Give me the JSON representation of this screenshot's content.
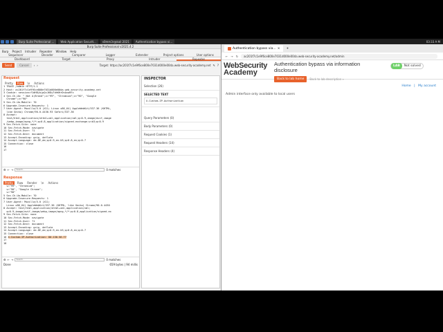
{
  "taskbar": {
    "tabs": [
      "Burp Suite Professional ...",
      "Web Application Securit...",
      "s0mm3r@kali:2021",
      "Authentication bypass vi..."
    ],
    "clock": "03:33 A M"
  },
  "burp": {
    "title": "Burp Suite Professional v2021.4.2",
    "menu": [
      "Burp",
      "Project",
      "Intruder",
      "Repeater",
      "Window",
      "Help"
    ],
    "tabs_top": [
      "Sequencer",
      "Decoder",
      "Comparer",
      "Logger",
      "Extender",
      "Project options",
      "User options"
    ],
    "tabs_bottom": [
      "Dashboard",
      "Target",
      "Proxy",
      "Intruder",
      "Repeater"
    ],
    "send_label": "Send",
    "cancel_label": "Cancel",
    "target": "Target: https://ac201f7c1e9f6ce800e7031d000e00da.web-security-academy.net",
    "request": {
      "title": "Request",
      "subtabs": [
        "Pretty",
        "Raw",
        "\\n",
        "Actions"
      ],
      "lines": [
        "1 TRACE /admin HTTP/1.1",
        "2 Host: ac201f7c1e9f6ce800e7031d000e00da.web-security-academy.net",
        "3 Cookie: session=f1dH8jbjpQcJ6DyTdhKHrDnAvwRFz",
        "4 Sec-Ch-Ua: \" Not A;Brand\";v=\"99\", \"Chromium\";v=\"90\", \"Google",
        "  Chrome\";v=\"90\"",
        "5 Sec-Ch-Ua-Mobile: ?0",
        "6 Upgrade-Insecure-Requests: 1",
        "7 User-Agent: Mozilla/5.0 (X11; Linux x86_64) AppleWebKit/537.36 (KHTML,",
        "  like Gecko) Chrome/90.0.4430.93 Safari/537.36",
        "8 Accept:",
        "  text/html,application/xhtml+xml,application/xml;q=0.9,image/avif,image",
        "  /webp,image/apng,*/*;q=0.8,application/signed-exchange;v=b3;q=0.9",
        "9 Sec-Fetch-Site: none",
        "10 Sec-Fetch-Mode: navigate",
        "11 Sec-Fetch-User: ?1",
        "12 Sec-Fetch-Dest: document",
        "13 Accept-Encoding: gzip, deflate",
        "14 Accept-Language: de-DE,de;q=0.9,en-US;q=0.8,en;q=0.7",
        "15 Connection: close",
        "16",
        "17"
      ],
      "search_placeholder": "Search...",
      "matches": "0 matches"
    },
    "response": {
      "title": "Response",
      "subtabs": [
        "Pretty",
        "Raw",
        "Render",
        "\\n",
        "Actions"
      ],
      "lines": [
        "  v=\"99\", \"Chromium\";",
        "  v=\"90\", \"Google Chrome\";",
        "  v=\"90\"",
        "5 Sec-Ch-Ua-Mobile: ?0",
        "6 Upgrade-Insecure-Requests: 1",
        "7 User-Agent: Mozilla/5.0 (X11;",
        "  Linux x86_64) AppleWebKit/537.36 (KHTML, like Gecko) Chrome/90.0.4430",
        "8 Accept: text/html,application/xhtml+xml,application/xml;",
        "  q=0.9,image/avif,image/webp,image/apng,*/*;q=0.8,application/signed-ex",
        "9 Sec-Fetch-Site: none",
        "10 Sec-Fetch-Mode: navigate",
        "11 Sec-Fetch-User: ?1",
        "12 Sec-Fetch-Dest: document",
        "13 Accept-Encoding: gzip, deflate",
        "14 Accept-Language: de-DE,de;q=0.9,en-US;q=0.8,en;q=0.7",
        "15 Connection: close"
      ],
      "highlight_line": "X-Custom-IP-Authorization: 80.130.56.77",
      "highlight_num": "16",
      "tail": [
        "17",
        "18"
      ],
      "search_placeholder": "Search...",
      "matches": "0 matches"
    },
    "status_left": "Done",
    "status_right": "659 bytes | 94 millis",
    "inspector": {
      "title": "INSPECTOR",
      "selection": "Selection (26)",
      "selected_text_label": "SELECTED TEXT",
      "selected_text": "X-Custom-IP-Authorization",
      "rows": [
        "Query Parameters (0)",
        "Body Parameters (0)",
        "Request Cookies (1)",
        "Request Headers (14)",
        "Response Headers (4)"
      ]
    }
  },
  "browser": {
    "tab_title": "Authentication bypass via...",
    "url": "ac201f7c1e9f6ce800e7031d000e00da.web-security-academy.net/admin",
    "logo_line1": "WebSecurity",
    "logo_line2": "Academy",
    "lab_title": "Authentication bypass via information disclosure",
    "back_button": "Back to lab home",
    "desc_link": "Back to lab description »",
    "lab_badge": "LAB",
    "lab_status": "Not solved",
    "nav_home": "Home",
    "nav_sep": "|",
    "nav_account": "My account",
    "message": "Admin interface only available to local users"
  }
}
